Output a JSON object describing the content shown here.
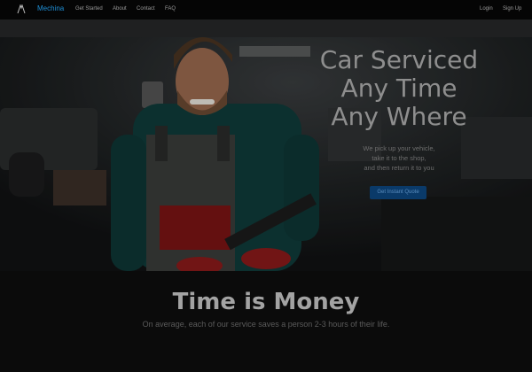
{
  "navbar": {
    "brand": "Mechina",
    "links": [
      "Get Started",
      "About",
      "Contact",
      "FAQ"
    ],
    "right_links": [
      "Login",
      "Sign Up"
    ]
  },
  "hero": {
    "headline": [
      "Car Serviced",
      "Any Time",
      "Any Where"
    ],
    "subtext": [
      "We pick up your vehicle,",
      "take it to the shop,",
      "and then return it to you"
    ],
    "cta": "Get Instant Quote"
  },
  "section": {
    "title": "Time is Money",
    "subtitle": "On average, each of our service saves a person 2-3 hours of their life."
  },
  "colors": {
    "brand": "#1f8fd6",
    "cta_bg": "#0a3a69",
    "page_bg": "#0b0b0b"
  }
}
